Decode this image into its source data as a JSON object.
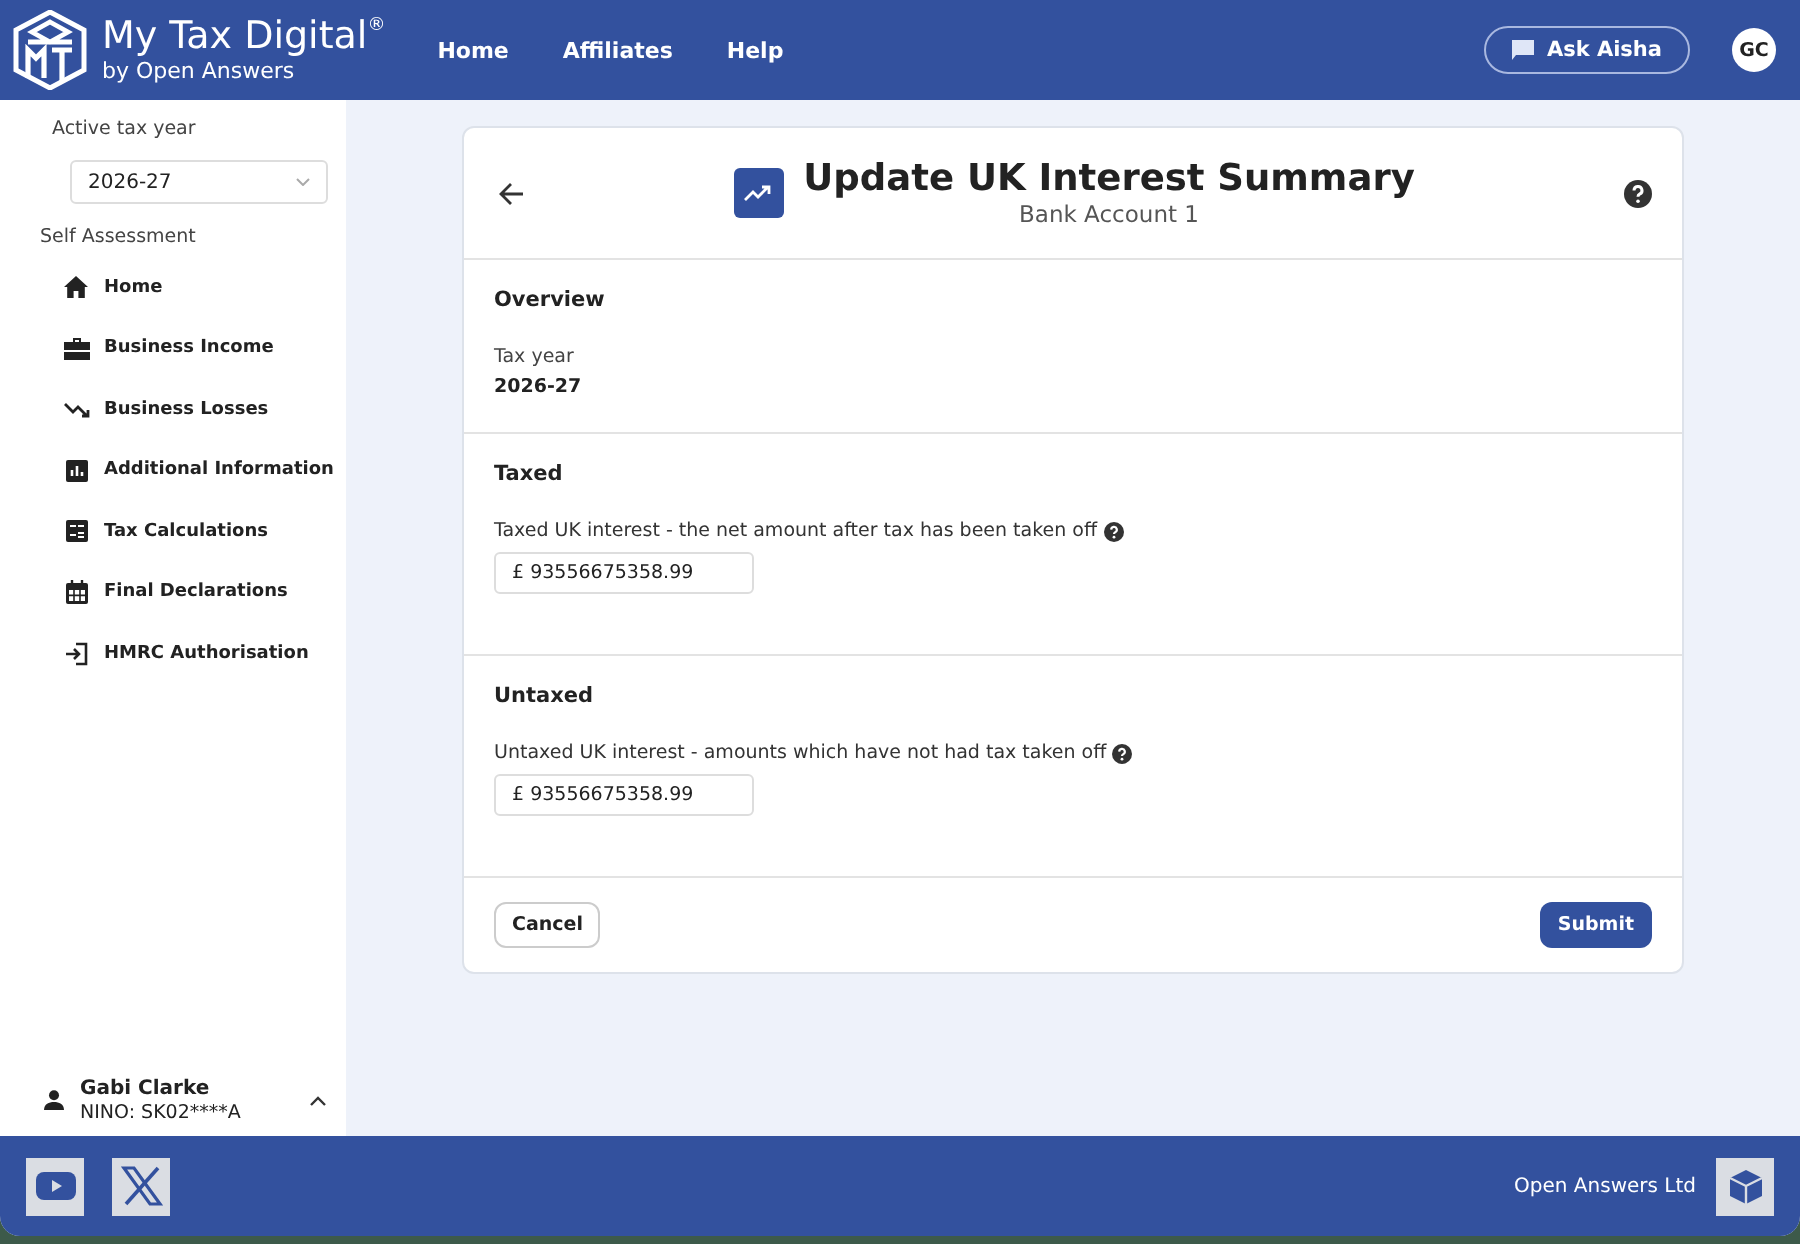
{
  "header": {
    "brand": "My Tax Digital$^{®}$",
    "tagline": "by Open Answers",
    "nav": [
      "Home",
      "Affiliates",
      "Help"
    ],
    "assistant_button": "Ask Aisha",
    "avatar": "GC"
  },
  "sidebar": {
    "tax_year_label": "Active tax year",
    "tax_year": "2026-27",
    "section": "Self Assessment",
    "items": [
      {
        "label": "Home"
      },
      {
        "label": "Business Income"
      },
      {
        "label": "Business Losses"
      },
      {
        "label": "Additional Information"
      },
      {
        "label": "Tax Calculations"
      },
      {
        "label": "Final Declarations"
      },
      {
        "label": "HMRC Authorisation"
      }
    ],
    "user": {
      "name": "Gabi Clarke",
      "nino": "NINO: SK02****A"
    }
  },
  "card": {
    "title": "Update UK Interest Summary",
    "subtitle": "Bank Account 1",
    "sections": [
      {
        "kind": "readonly",
        "heading": "Overview",
        "label": "Tax year",
        "value": "2026-27"
      },
      {
        "kind": "amount",
        "heading": "Taxed",
        "label": "Taxed UK interest - the net amount after tax has been taken off",
        "value": "£ 93556675358.99"
      },
      {
        "kind": "amount",
        "heading": "Untaxed",
        "label": "Untaxed UK interest - amounts which have not had tax taken off",
        "value": "£ 93556675358.99"
      }
    ],
    "cancel_button": "Cancel",
    "submit_button": "Submit"
  },
  "footer": {
    "company": "Open Answers Ltd"
  }
}
